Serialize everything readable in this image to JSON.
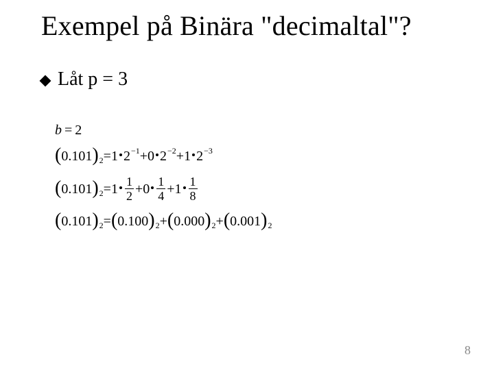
{
  "title": "Exempel på Binära \"decimaltal\"?",
  "bullet": {
    "text": "Låt p = 3"
  },
  "math": {
    "line1": {
      "lhs_var": "b",
      "eq": "=",
      "rhs": "2"
    },
    "line2": {
      "open": "(",
      "mantissa": "0.101",
      "close": ")",
      "base_sub": "2",
      "eq": "=",
      "t1_coef": "1",
      "t1_base": "2",
      "t1_exp": "−1",
      "plus1": "+",
      "t2_coef": "0",
      "t2_base": "2",
      "t2_exp": "−2",
      "plus2": "+",
      "t3_coef": "1",
      "t3_base": "2",
      "t3_exp": "−3"
    },
    "line3": {
      "open": "(",
      "mantissa": "0.101",
      "close": ")",
      "base_sub": "2",
      "eq": "=",
      "t1_coef": "1",
      "t1_num": "1",
      "t1_den": "2",
      "plus1": "+",
      "t2_coef": "0",
      "t2_num": "1",
      "t2_den": "4",
      "plus2": "+",
      "t3_coef": "1",
      "t3_num": "1",
      "t3_den": "8"
    },
    "line4": {
      "lhs_open": "(",
      "lhs_m": "0.101",
      "lhs_close": ")",
      "lhs_sub": "2",
      "eq": "=",
      "a_open": "(",
      "a_m": "0.100",
      "a_close": ")",
      "a_sub": "2",
      "plus1": "+",
      "b_open": "(",
      "b_m": "0.000",
      "b_close": ")",
      "b_sub": "2",
      "plus2": "+",
      "c_open": "(",
      "c_m": "0.001",
      "c_close": ")",
      "c_sub": "2"
    }
  },
  "page_number": "8"
}
